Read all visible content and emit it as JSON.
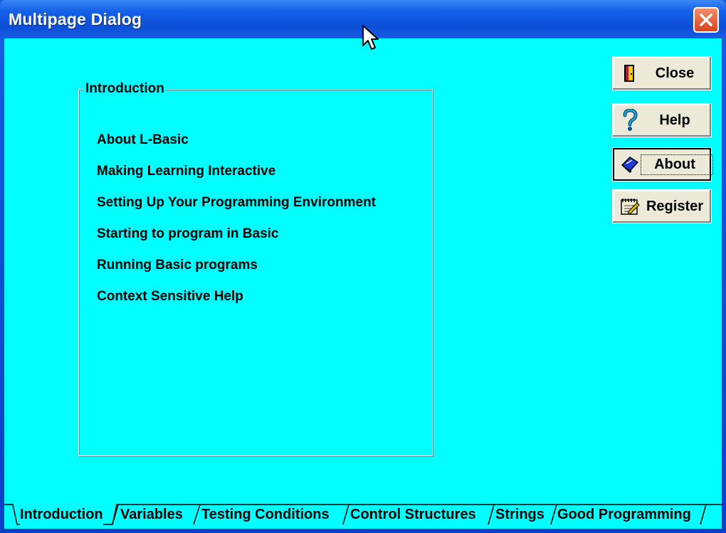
{
  "window": {
    "title": "Multipage Dialog"
  },
  "frame": {
    "legend": "Introduction",
    "topics": [
      "About L-Basic",
      "Making Learning Interactive",
      "Setting Up Your Programming Environment",
      "Starting to program in Basic",
      "Running Basic programs",
      "Context Sensitive Help"
    ]
  },
  "buttons": {
    "close": "Close",
    "help": "Help",
    "about": "About",
    "register": "Register"
  },
  "tabs": [
    "Introduction",
    "Variables",
    "Testing Conditions",
    "Control Structures",
    "Strings",
    "Good Programming"
  ],
  "active_tab": "Introduction",
  "colors": {
    "client_background": "#00ffff",
    "titlebar": "#0c4fd6"
  }
}
